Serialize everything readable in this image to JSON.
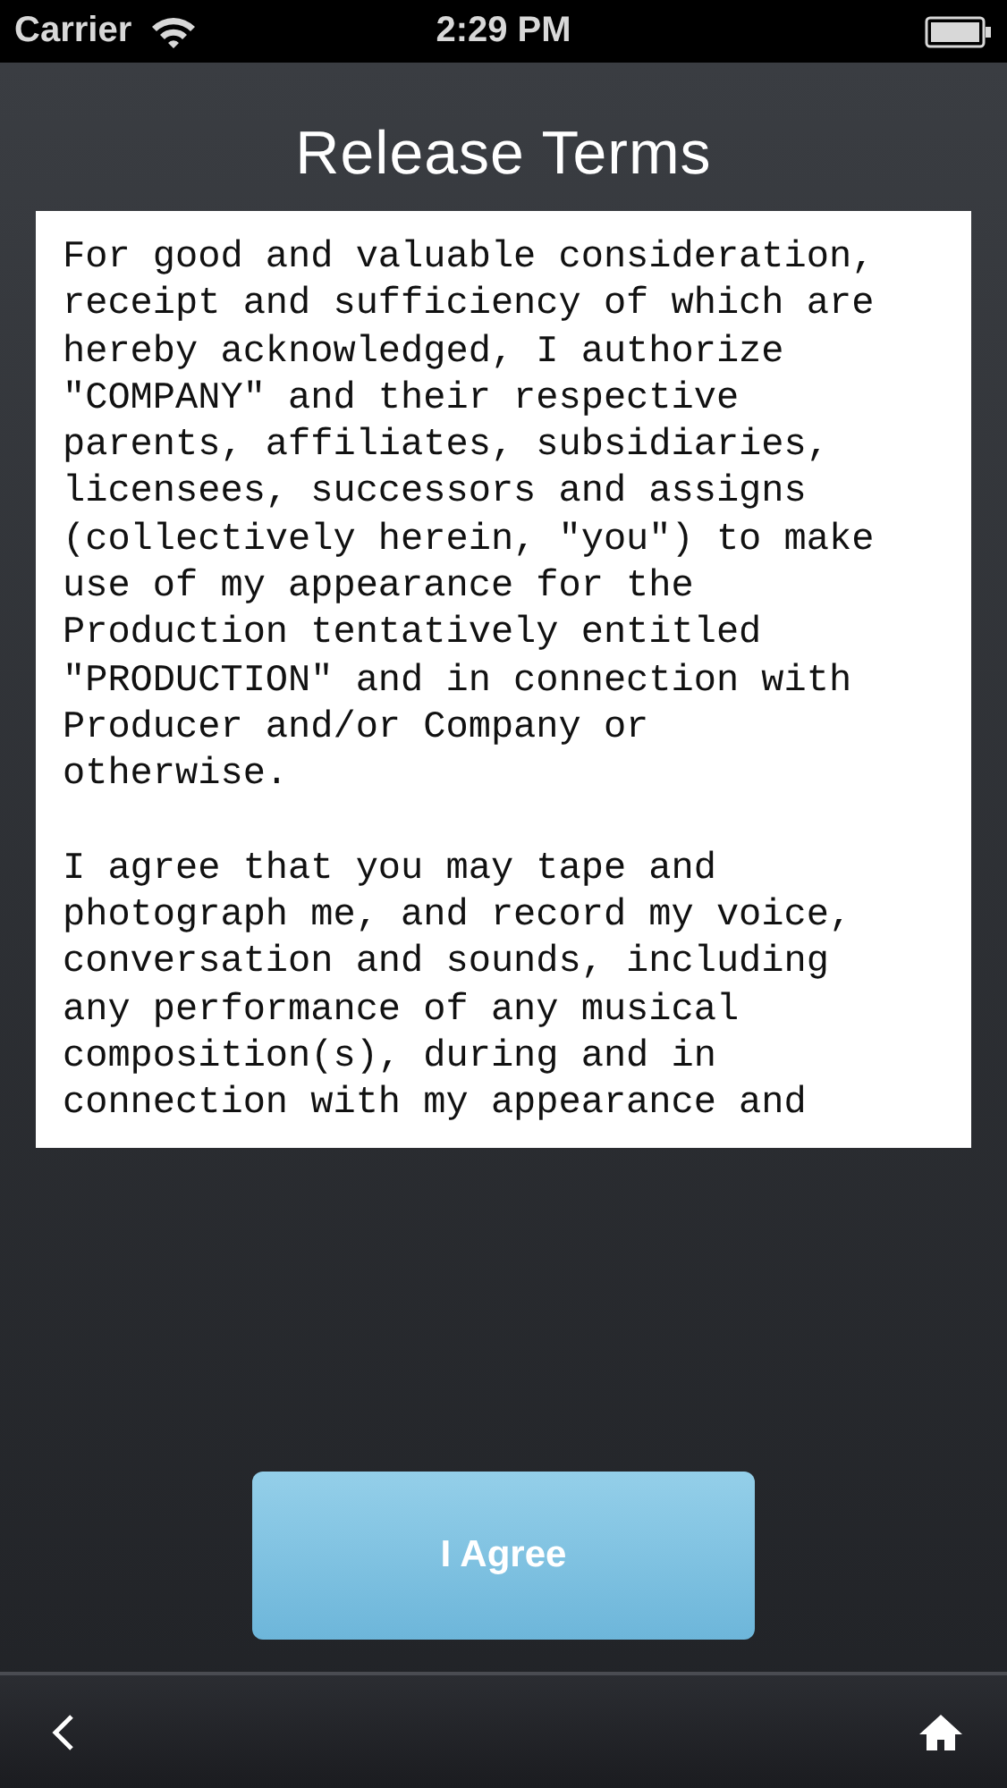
{
  "status_bar": {
    "carrier": "Carrier",
    "time": "2:29 PM"
  },
  "title": "Release Terms",
  "terms": [
    "For good and valuable consideration, receipt and sufficiency of which are hereby acknowledged, I authorize \"COMPANY\" and their respective parents, affiliates, subsidiaries, licensees, successors and assigns (collectively herein, \"you\") to make use of my appearance for the Production tentatively entitled \"PRODUCTION\" and in connection with Producer and/or Company or otherwise.",
    "I agree that you may tape and photograph me, and record my voice, conversation and sounds, including any performance of any musical composition(s), during and in connection with my appearance and"
  ],
  "agree_button": "I Agree"
}
